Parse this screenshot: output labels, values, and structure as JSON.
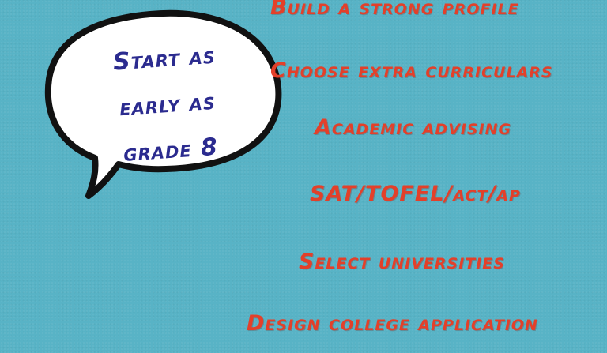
{
  "colors": {
    "background": "#58b3c6",
    "bubble_fill": "#ffffff",
    "bubble_outline": "#111111",
    "bubble_text": "#2b2b8f",
    "list_text": "#e3402a"
  },
  "bubble": {
    "lines": [
      "Start as",
      "early as",
      "grade 8"
    ]
  },
  "steps": [
    "Build a strong profile",
    "Choose extra curriculars",
    "Academic advising",
    "SAT/TOFEL/act/ap",
    "Select universities",
    "Design college application"
  ]
}
